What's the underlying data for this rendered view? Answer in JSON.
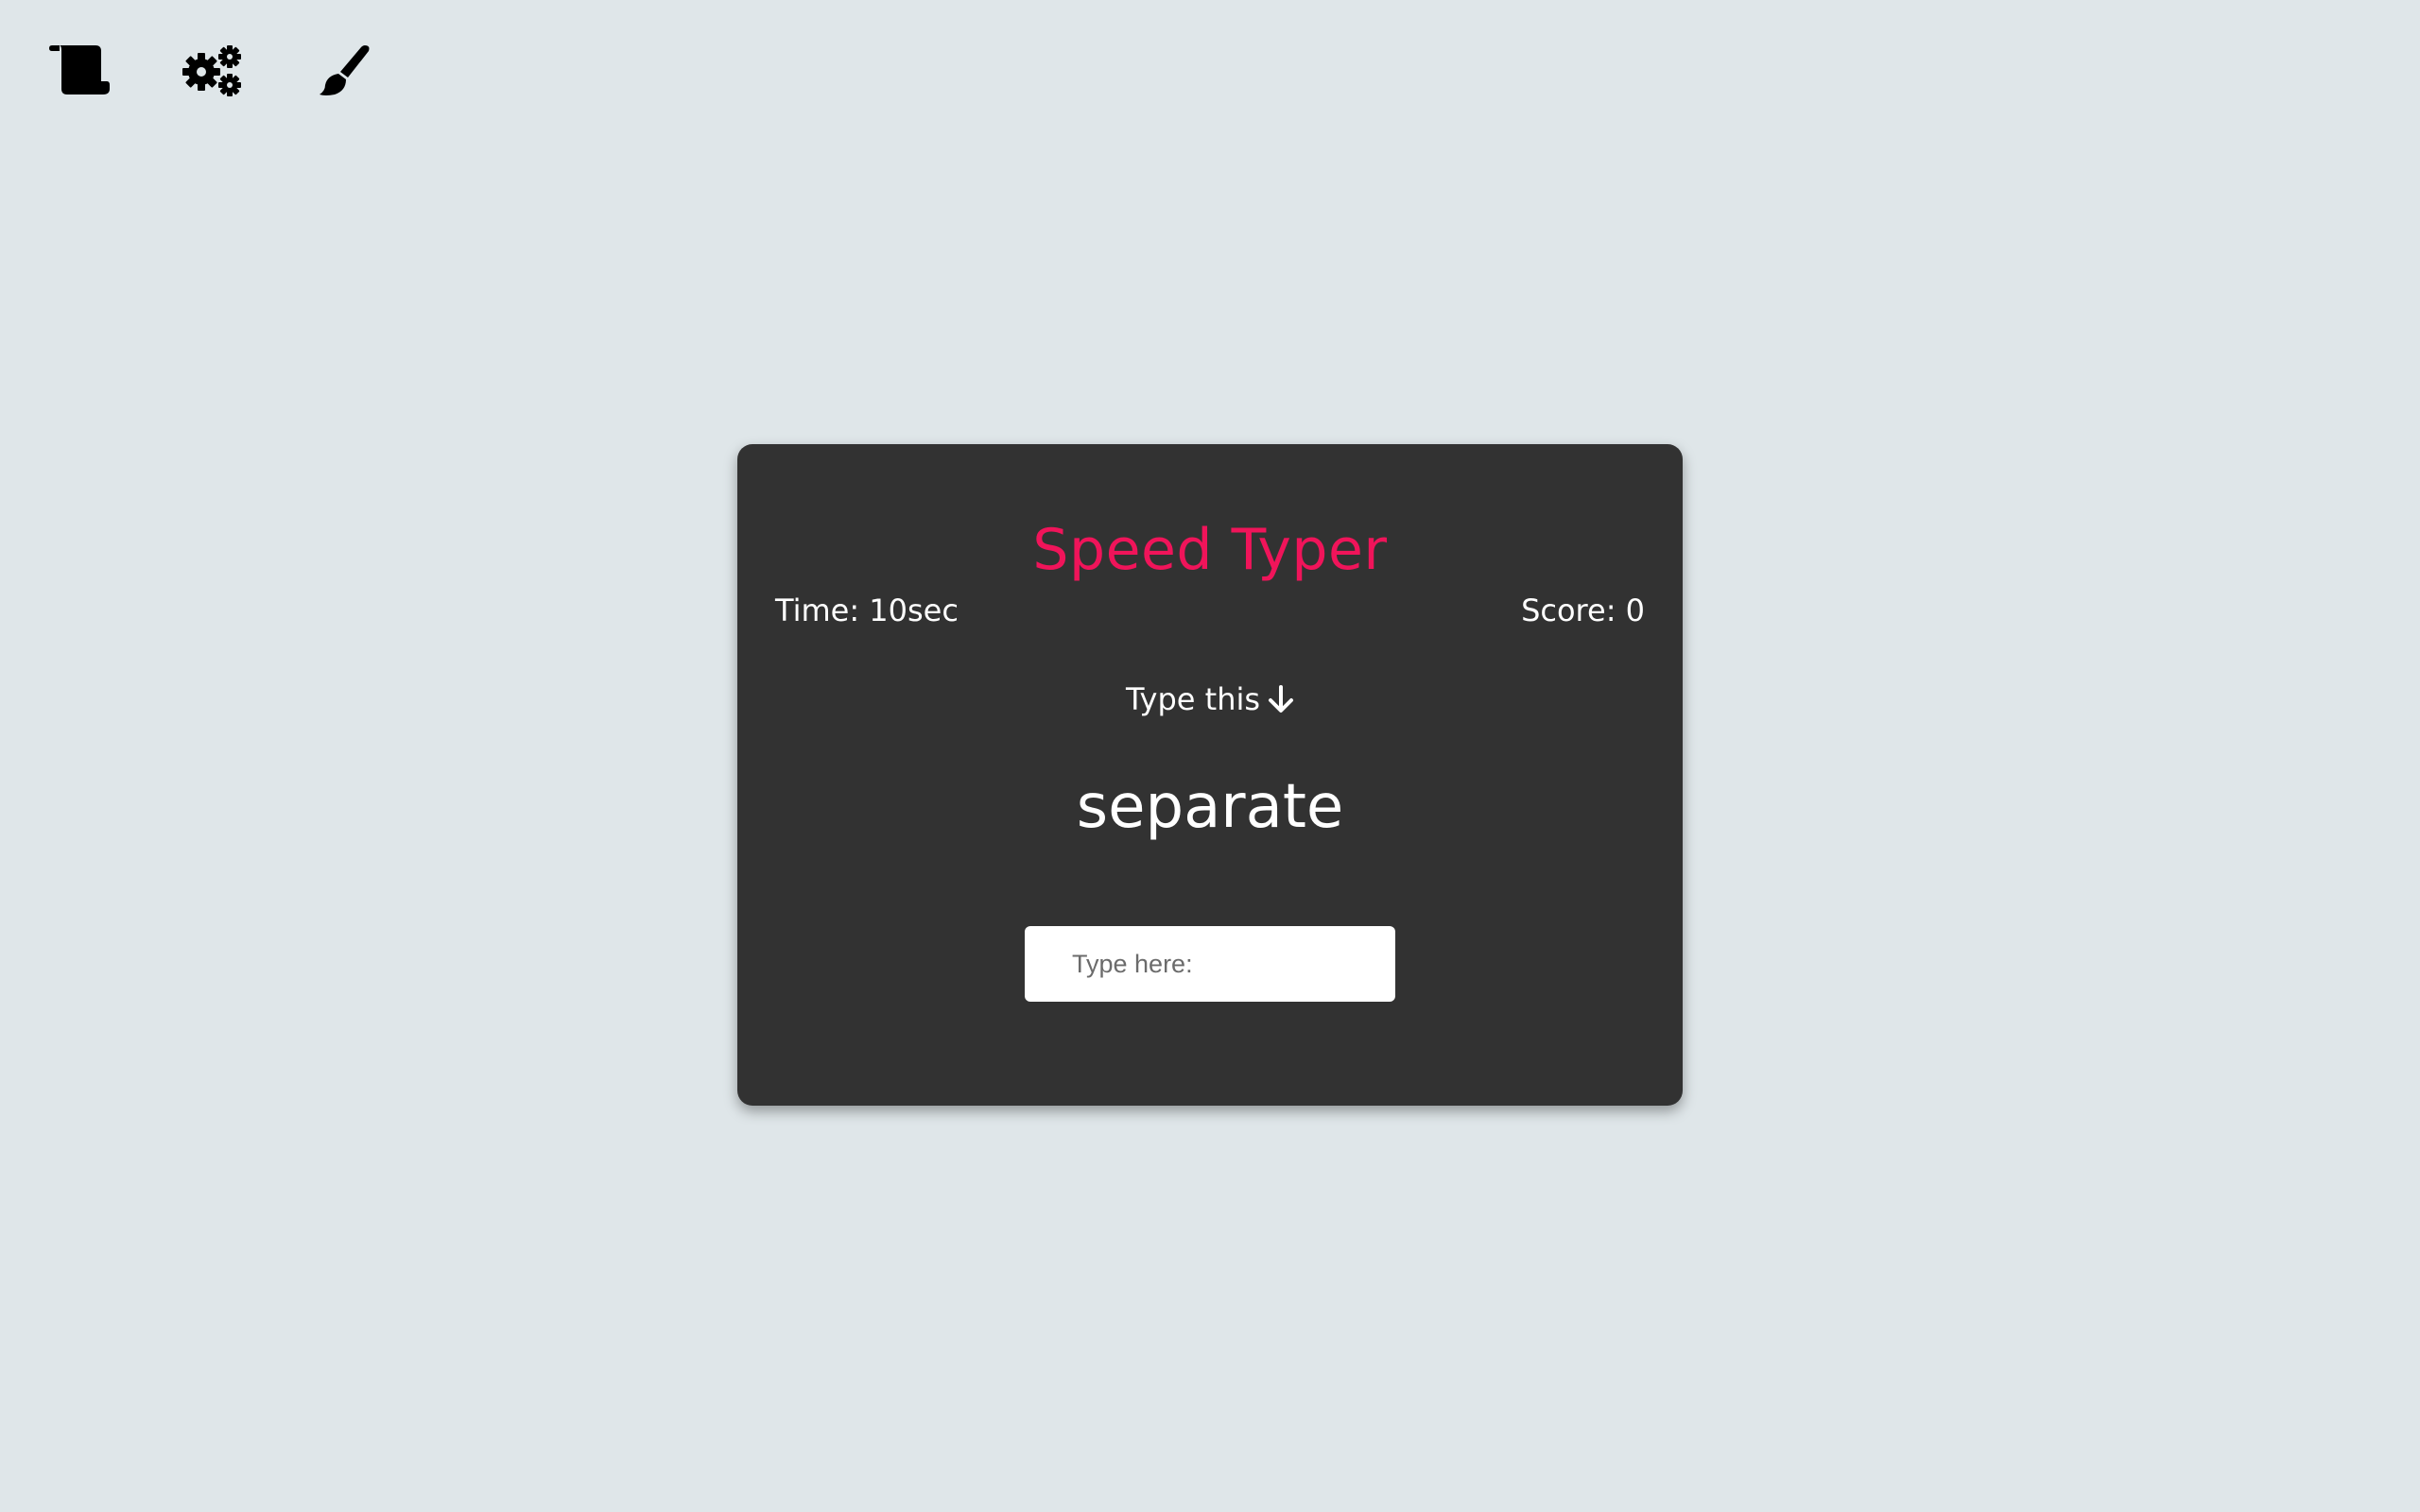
{
  "toolbar": {
    "icons": [
      "scroll-icon",
      "gears-icon",
      "paint-brush-icon"
    ]
  },
  "card": {
    "title": "Speed Typer",
    "time_label": "Time: 10sec",
    "score_label": "Score: 0",
    "prompt_label": "Type this",
    "prompt_icon": "arrow-down-icon",
    "word": "separate",
    "input_placeholder": "Type here:",
    "input_value": ""
  },
  "colors": {
    "background": "#dfe6e9",
    "card": "#323232",
    "title": "#f0145a",
    "text": "#ffffff"
  }
}
